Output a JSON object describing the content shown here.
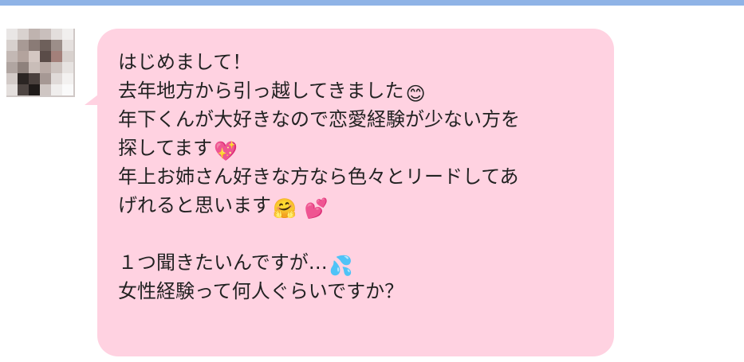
{
  "message": {
    "lines": [
      "はじめまして！",
      "去年地方から引っ越してきました",
      "年下くんが大好きなので恋愛経験が少ない方を",
      "探してます",
      "年上お姉さん好きな方なら色々とリードしてあ",
      "げれると思います",
      "",
      "１つ聞きたいんですが…",
      "女性経験って何人ぐらいですか？"
    ],
    "emojis": {
      "smile": "😊",
      "sparkling_heart": "💖",
      "hug": "🤗",
      "two_hearts": "💕",
      "sweat_droplets": "💦"
    }
  },
  "colors": {
    "bubble": "#ffd2e1",
    "topbar": "#8fb3e6",
    "text": "#222222"
  }
}
